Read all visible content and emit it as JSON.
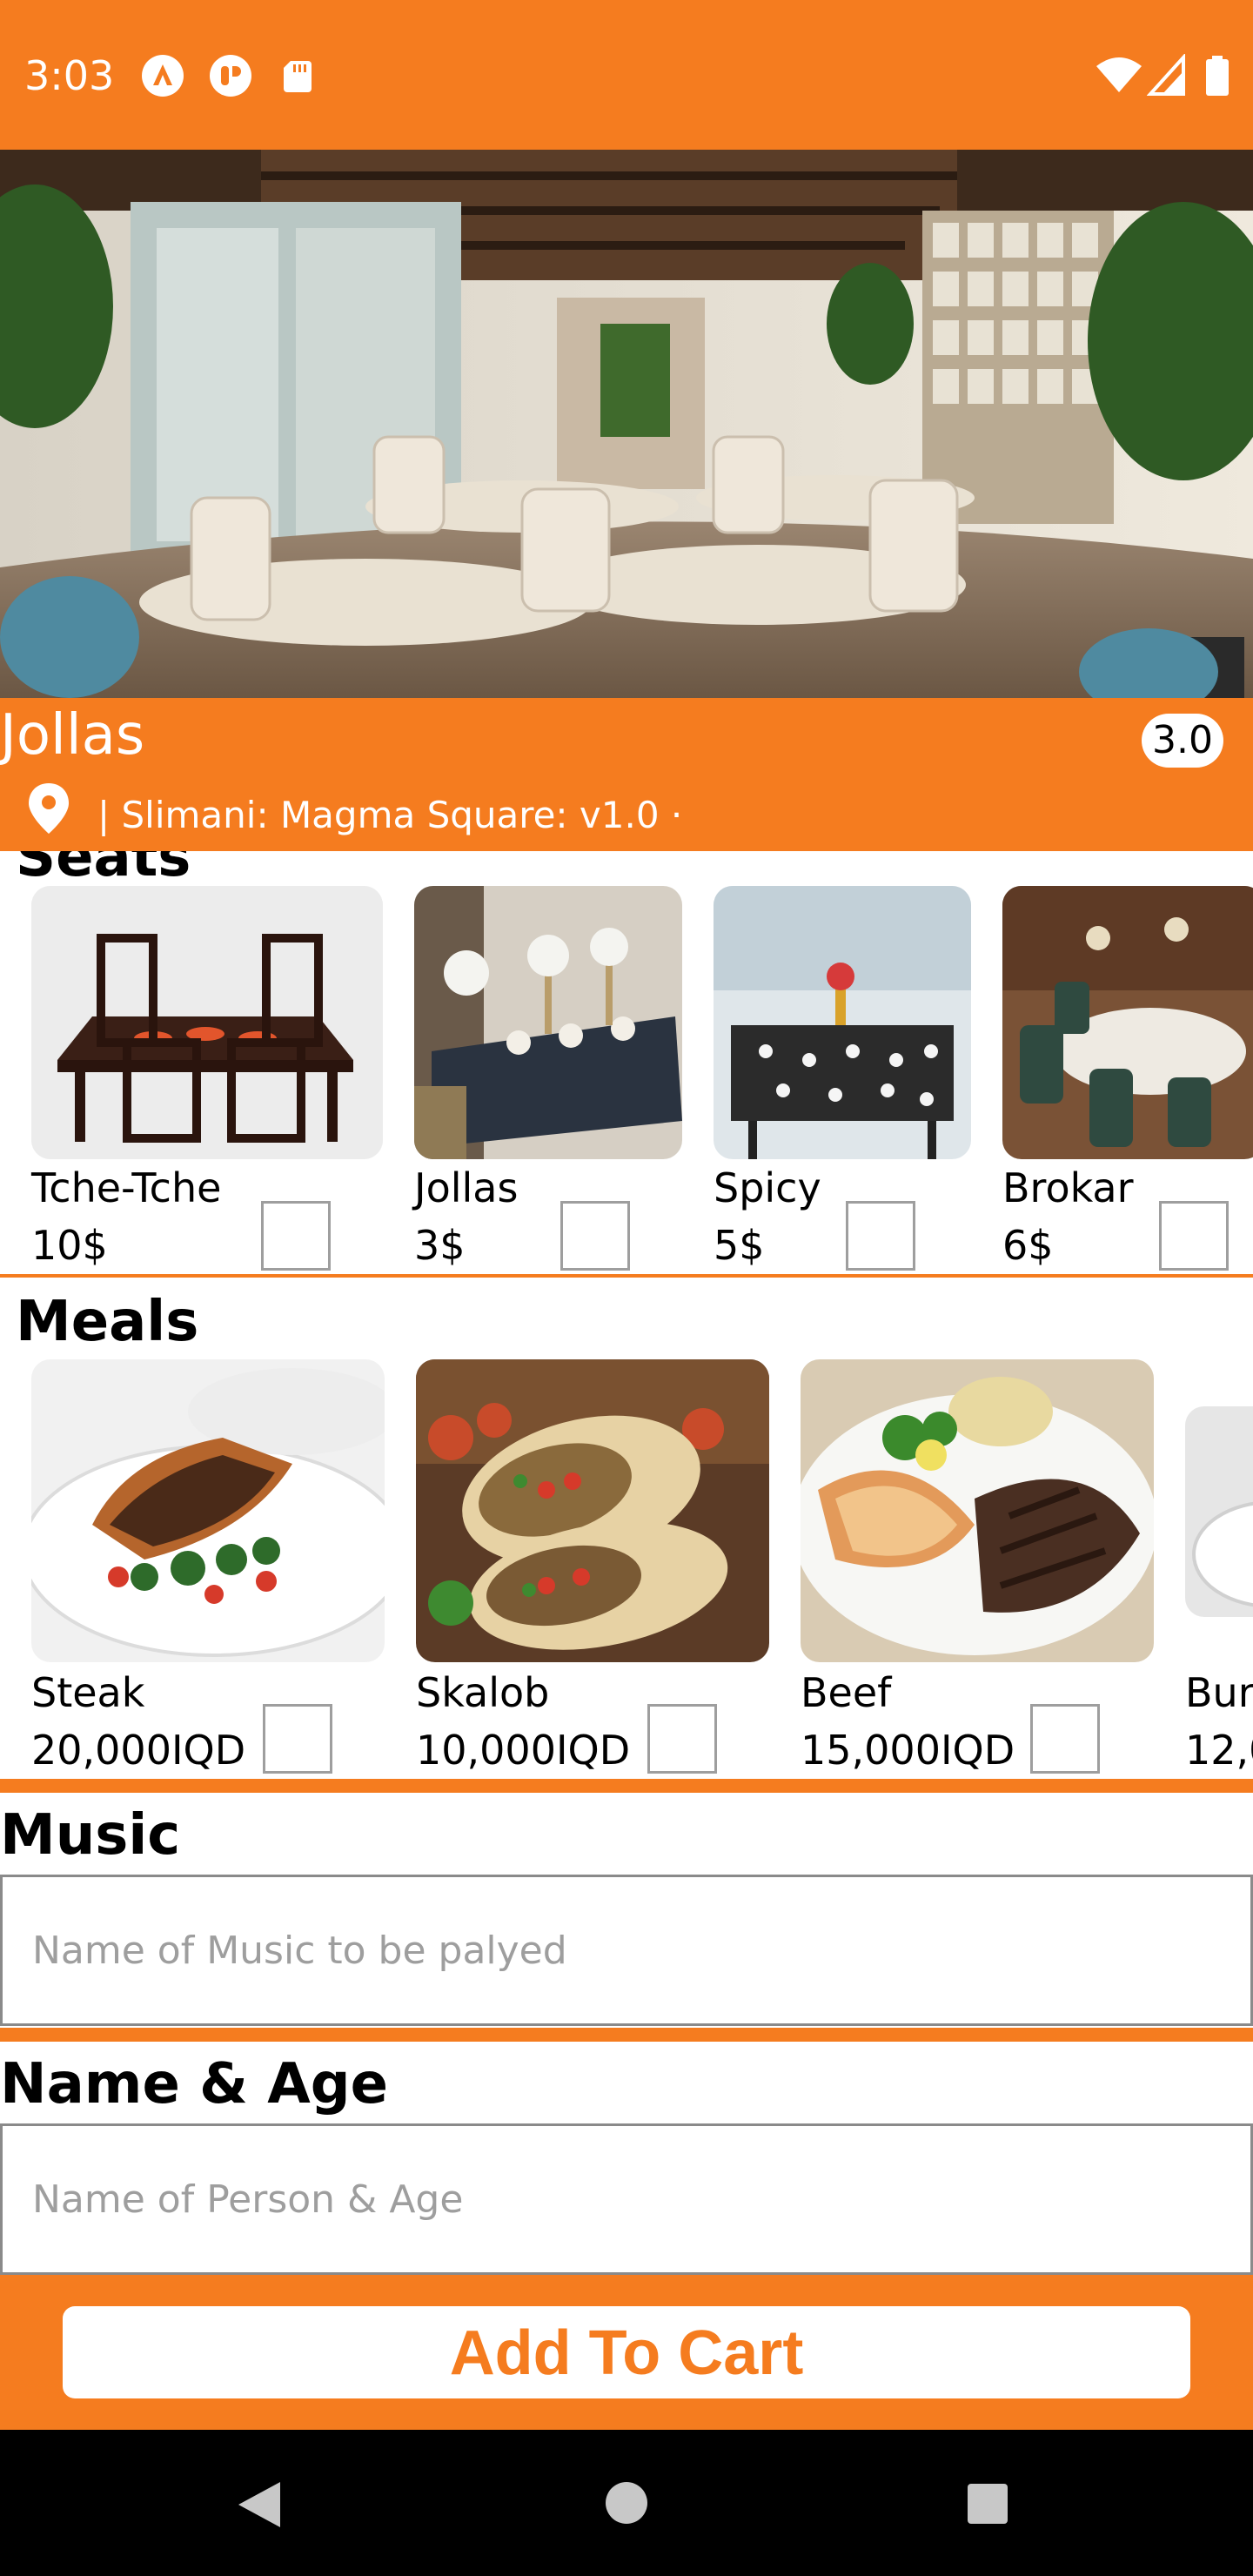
{
  "status_bar": {
    "time": "3:03"
  },
  "restaurant": {
    "name": "Jollas",
    "rating": "3.0",
    "location": "|  Slimani: Magma Square: v1.0 ·"
  },
  "seats": {
    "title": "Seats",
    "items": [
      {
        "name": "Tche-Tche",
        "price": "10$"
      },
      {
        "name": "Jollas",
        "price": "3$"
      },
      {
        "name": "Spicy",
        "price": "5$"
      },
      {
        "name": "Brokar",
        "price": "6$"
      }
    ]
  },
  "meals": {
    "title": "Meals",
    "items": [
      {
        "name": "Steak",
        "price": "20,000IQD"
      },
      {
        "name": "Skalob",
        "price": "10,000IQD"
      },
      {
        "name": "Beef",
        "price": "15,000IQD"
      },
      {
        "name": "Bur",
        "price": "12,0"
      }
    ]
  },
  "music": {
    "title": "Music",
    "placeholder": "Name of Music to be palyed"
  },
  "person": {
    "title": "Name & Age",
    "placeholder": "Name of Person & Age"
  },
  "cart": {
    "label": "Add To Cart"
  },
  "colors": {
    "accent": "#f57c1f",
    "text": "#000000",
    "placeholder": "#9e9e9e"
  }
}
